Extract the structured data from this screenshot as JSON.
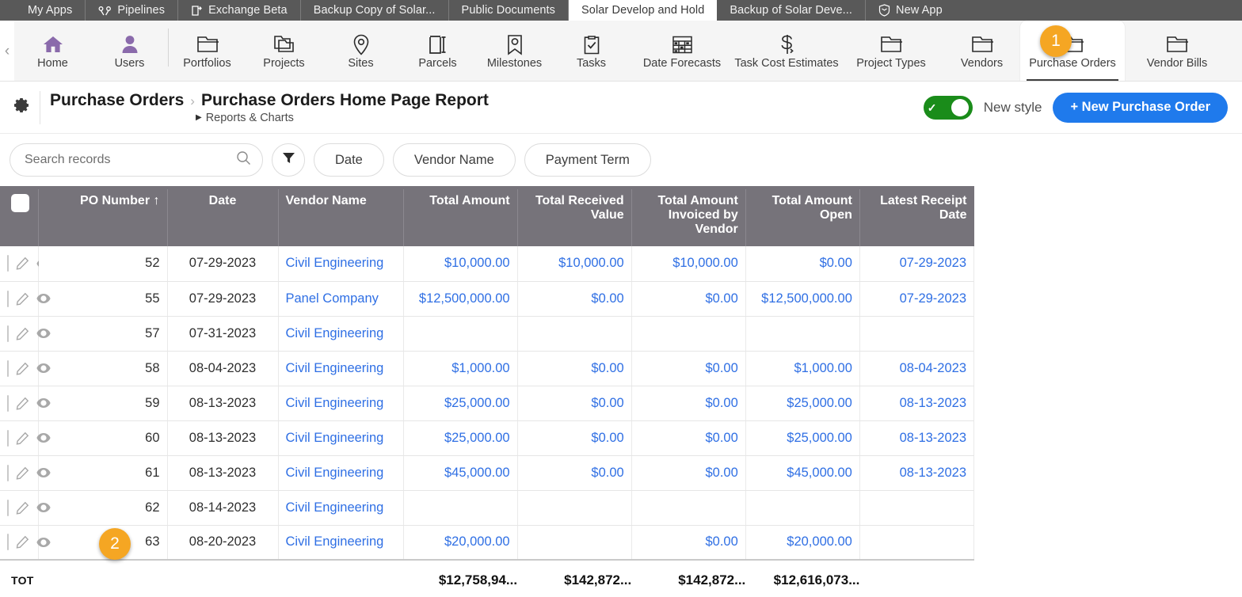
{
  "app_tabs": [
    {
      "label": "My Apps",
      "icon": "apps-grid-icon",
      "active": false
    },
    {
      "label": "Pipelines",
      "icon": "pipelines-icon",
      "active": false
    },
    {
      "label": "Exchange Beta",
      "icon": "exchange-icon",
      "active": false
    },
    {
      "label": "Backup Copy of Solar...",
      "icon": "",
      "active": false
    },
    {
      "label": "Public Documents",
      "icon": "",
      "active": false
    },
    {
      "label": "Solar Develop and Hold",
      "icon": "",
      "active": true
    },
    {
      "label": "Backup of Solar Deve...",
      "icon": "",
      "active": false
    },
    {
      "label": "New App",
      "icon": "shield-icon",
      "active": false
    }
  ],
  "app_nav": {
    "collapse_icon": "chevron-left-icon",
    "items": [
      {
        "label": "Home",
        "icon": "home-icon",
        "selected": false,
        "wide": false
      },
      {
        "label": "Users",
        "icon": "user-icon",
        "selected": false,
        "wide": false
      },
      {
        "label": "Portfolios",
        "icon": "folder-icon",
        "selected": false,
        "wide": false
      },
      {
        "label": "Projects",
        "icon": "folders-icon",
        "selected": false,
        "wide": false
      },
      {
        "label": "Sites",
        "icon": "map-pin-icon",
        "selected": false,
        "wide": false
      },
      {
        "label": "Parcels",
        "icon": "parcel-icon",
        "selected": false,
        "wide": false
      },
      {
        "label": "Milestones",
        "icon": "milestone-icon",
        "selected": false,
        "wide": false
      },
      {
        "label": "Tasks",
        "icon": "clipboard-check-icon",
        "selected": false,
        "wide": false
      },
      {
        "label": "Date Forecasts",
        "icon": "calendar-grid-icon",
        "selected": false,
        "wide": true
      },
      {
        "label": "Task Cost Estimates",
        "icon": "dollar-swap-icon",
        "selected": false,
        "wide": true
      },
      {
        "label": "Project Types",
        "icon": "folder-icon",
        "selected": false,
        "wide": false
      },
      {
        "label": "Vendors",
        "icon": "folder-icon",
        "selected": false,
        "wide": false
      },
      {
        "label": "Purchase Orders",
        "icon": "folder-icon",
        "selected": true,
        "wide": true
      },
      {
        "label": "Vendor Bills",
        "icon": "folder-icon",
        "selected": false,
        "wide": false
      }
    ]
  },
  "header": {
    "gear_icon": "gear-icon",
    "breadcrumb_app": "Purchase Orders",
    "breadcrumb_separator": "›",
    "breadcrumb_report": "Purchase Orders Home Page Report",
    "sub_breadcrumb": "Reports & Charts",
    "sub_caret_icon": "caret-right-icon",
    "new_style_label": "New style",
    "new_style_on": true,
    "new_record_button": "+ New Purchase Order",
    "accent_color": "#1f7aec",
    "toggle_on_color": "#1a8c1a"
  },
  "filters": {
    "search_placeholder": "Search records",
    "search_value": "",
    "search_icon": "search-icon",
    "funnel_icon": "funnel-icon",
    "pills": [
      "Date",
      "Vendor Name",
      "Payment Term"
    ]
  },
  "table": {
    "header_bg": "#76737a",
    "link_color": "#2f6fe4",
    "columns": [
      {
        "key": "check",
        "label": ""
      },
      {
        "key": "po",
        "label": "PO Number ↑"
      },
      {
        "key": "date",
        "label": "Date"
      },
      {
        "key": "vendor",
        "label": "Vendor Name"
      },
      {
        "key": "total",
        "label": "Total Amount"
      },
      {
        "key": "recv",
        "label": "Total Received Value"
      },
      {
        "key": "inv",
        "label": "Total Amount Invoiced by Vendor"
      },
      {
        "key": "open",
        "label": "Total Amount Open"
      },
      {
        "key": "receipt",
        "label": "Latest Receipt Date"
      }
    ],
    "sort_indicator": "↑",
    "row_icons": {
      "edit": "pencil-icon",
      "view": "eye-icon",
      "select": "row-checkbox"
    },
    "rows": [
      {
        "po": "52",
        "date": "07-29-2023",
        "vendor": "Civil Engineering",
        "total": "$10,000.00",
        "recv": "$10,000.00",
        "inv": "$10,000.00",
        "open": "$0.00",
        "receipt": "07-29-2023"
      },
      {
        "po": "55",
        "date": "07-29-2023",
        "vendor": "Panel Company",
        "total": "$12,500,000.00",
        "recv": "$0.00",
        "inv": "$0.00",
        "open": "$12,500,000.00",
        "receipt": "07-29-2023"
      },
      {
        "po": "57",
        "date": "07-31-2023",
        "vendor": "Civil Engineering",
        "total": "",
        "recv": "",
        "inv": "",
        "open": "",
        "receipt": ""
      },
      {
        "po": "58",
        "date": "08-04-2023",
        "vendor": "Civil Engineering",
        "total": "$1,000.00",
        "recv": "$0.00",
        "inv": "$0.00",
        "open": "$1,000.00",
        "receipt": "08-04-2023"
      },
      {
        "po": "59",
        "date": "08-13-2023",
        "vendor": "Civil Engineering",
        "total": "$25,000.00",
        "recv": "$0.00",
        "inv": "$0.00",
        "open": "$25,000.00",
        "receipt": "08-13-2023"
      },
      {
        "po": "60",
        "date": "08-13-2023",
        "vendor": "Civil Engineering",
        "total": "$25,000.00",
        "recv": "$0.00",
        "inv": "$0.00",
        "open": "$25,000.00",
        "receipt": "08-13-2023"
      },
      {
        "po": "61",
        "date": "08-13-2023",
        "vendor": "Civil Engineering",
        "total": "$45,000.00",
        "recv": "$0.00",
        "inv": "$0.00",
        "open": "$45,000.00",
        "receipt": "08-13-2023"
      },
      {
        "po": "62",
        "date": "08-14-2023",
        "vendor": "Civil Engineering",
        "total": "",
        "recv": "",
        "inv": "",
        "open": "",
        "receipt": ""
      },
      {
        "po": "63",
        "date": "08-20-2023",
        "vendor": "Civil Engineering",
        "total": "$20,000.00",
        "recv": "",
        "inv": "$0.00",
        "open": "$20,000.00",
        "receipt": ""
      }
    ],
    "totals": {
      "label": "TOT",
      "total": "$12,758,94...",
      "recv": "$142,872...",
      "inv": "$142,872...",
      "open": "$12,616,073...",
      "receipt": ""
    }
  },
  "annotations": [
    {
      "id": "1",
      "label": "1",
      "color": "#f5a623"
    },
    {
      "id": "2",
      "label": "2",
      "color": "#f5a623"
    }
  ]
}
